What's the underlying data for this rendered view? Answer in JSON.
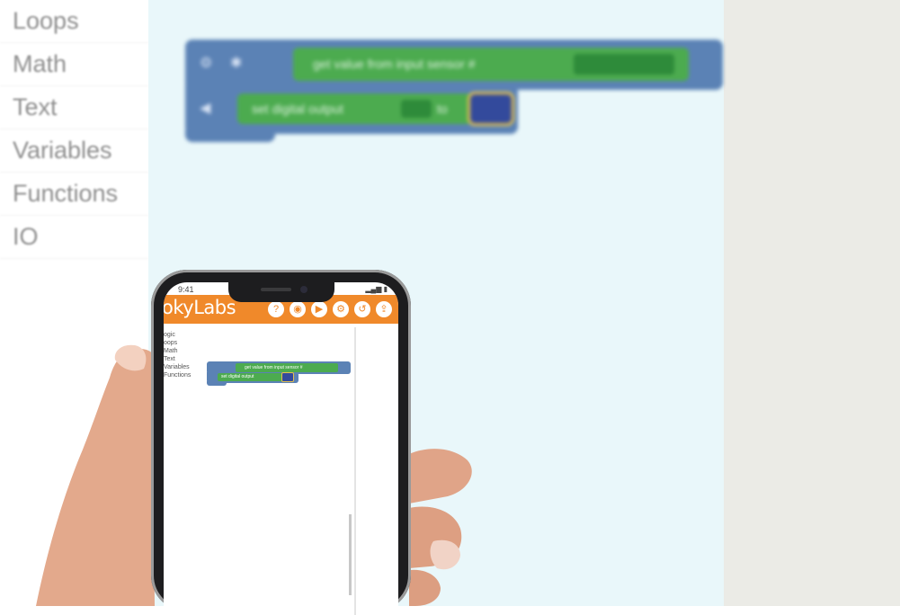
{
  "toolbox": {
    "items": [
      "Loops",
      "Math",
      "Text",
      "Variables",
      "Functions",
      "IO"
    ]
  },
  "workspace": {
    "block_value": "get value from input sensor #",
    "block_output": "set digital output",
    "block_output_to": "to"
  },
  "phone": {
    "status_time": "9:41",
    "status_icons": "▂▄▆ ▮",
    "app_logo": "okyLabs",
    "toolbar": [
      "?",
      "◉",
      "▶",
      "⚙",
      "↺",
      "⇪"
    ],
    "mini_toolbox": [
      "ogic",
      "oops",
      "Math",
      "Text",
      "Variables",
      "Functions"
    ],
    "mini_block_value": "get value from input sensor #",
    "mini_block_output": "set digital output"
  },
  "colors": {
    "workspace_bg": "#e9f7fa",
    "block_blue": "#5b82b5",
    "block_green": "#4cab4f",
    "app_bar_orange": "#f0892a",
    "right_panel": "#ebebe6"
  }
}
